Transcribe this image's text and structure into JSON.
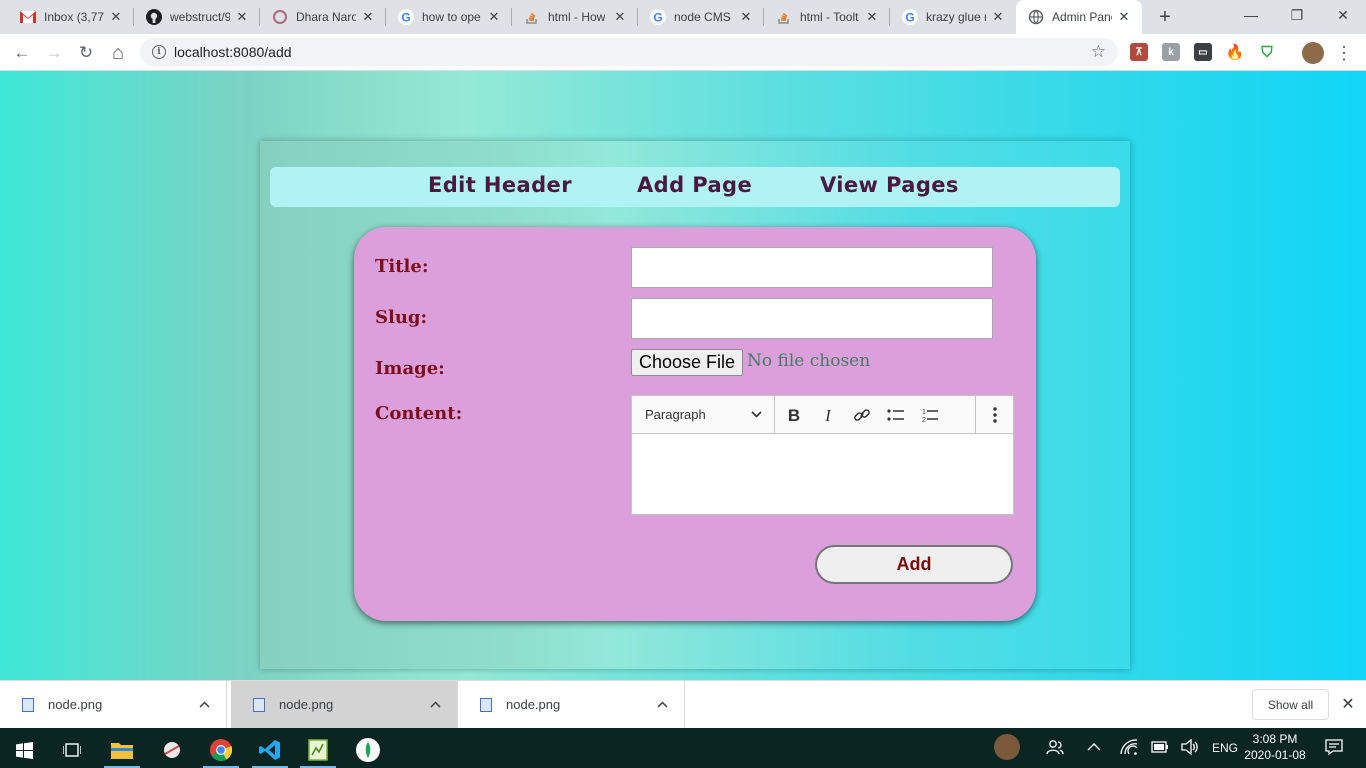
{
  "browser": {
    "tabs": [
      {
        "title": "Inbox (3,77",
        "icon": "gmail-icon"
      },
      {
        "title": "webstruct/9",
        "icon": "github-icon"
      },
      {
        "title": "Dhara Naro",
        "icon": "site-icon"
      },
      {
        "title": "how to ope",
        "icon": "google-icon"
      },
      {
        "title": "html - How",
        "icon": "stackoverflow-icon"
      },
      {
        "title": "node CMS i",
        "icon": "google-icon"
      },
      {
        "title": "html - Toolt",
        "icon": "stackoverflow-icon"
      },
      {
        "title": "krazy glue r",
        "icon": "google-icon"
      },
      {
        "title": "Admin Pane",
        "icon": "globe-icon"
      }
    ],
    "new_tab": "+",
    "window_controls": {
      "minimize": "—",
      "restore": "❐",
      "close": "✕"
    },
    "url": "localhost:8080/add",
    "nav": {
      "back": "←",
      "forward": "→",
      "reload": "↻",
      "home": "⌂",
      "star": "☆",
      "menu": "⋮"
    }
  },
  "admin": {
    "menu": [
      "Edit Header",
      "Add Page",
      "View Pages"
    ],
    "form": {
      "title_label": "Title:",
      "slug_label": "Slug:",
      "image_label": "Image:",
      "content_label": "Content:",
      "file_button": "Choose File",
      "file_status": "No file chosen",
      "heading_select": "Paragraph",
      "submit": "Add"
    }
  },
  "downloads": {
    "items": [
      "node.png",
      "node.png",
      "node.png"
    ],
    "show_all": "Show all"
  },
  "taskbar": {
    "lang": "ENG",
    "time": "3:08 PM",
    "date": "2020-01-08"
  },
  "colors": {
    "menu_text": "#4a1842",
    "label_text": "#7e0c1a",
    "form_bg": "#dba0dc",
    "menubar_bg": "#b1f3f5"
  }
}
